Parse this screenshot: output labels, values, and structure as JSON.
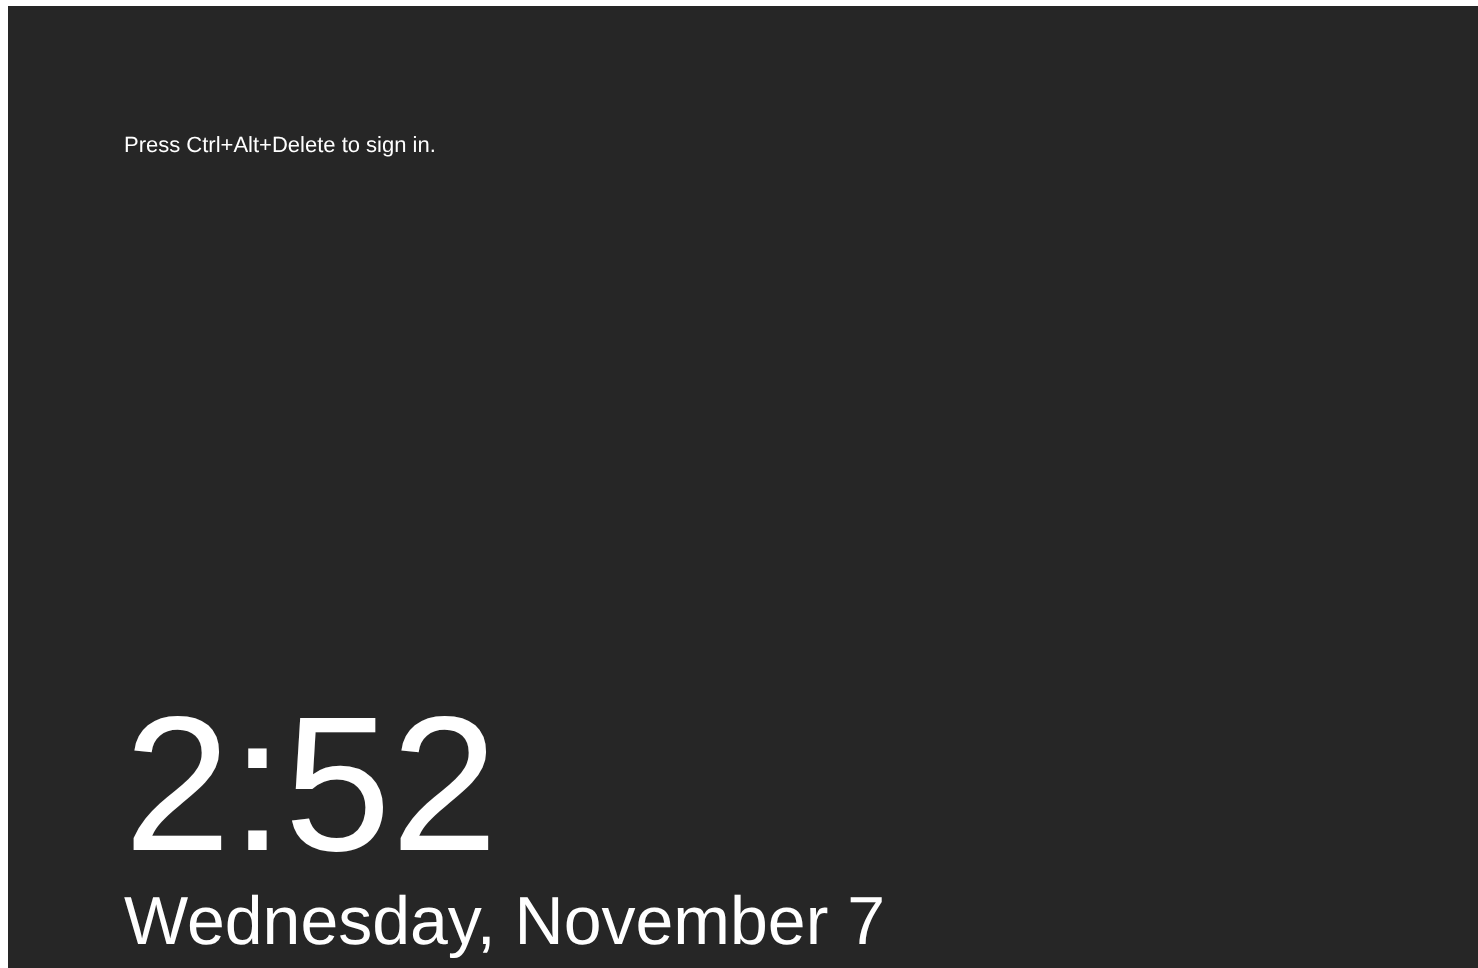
{
  "message": "Press Ctrl+Alt+Delete to sign in.",
  "clock": {
    "time": "2:52",
    "date": "Wednesday, November 7"
  }
}
